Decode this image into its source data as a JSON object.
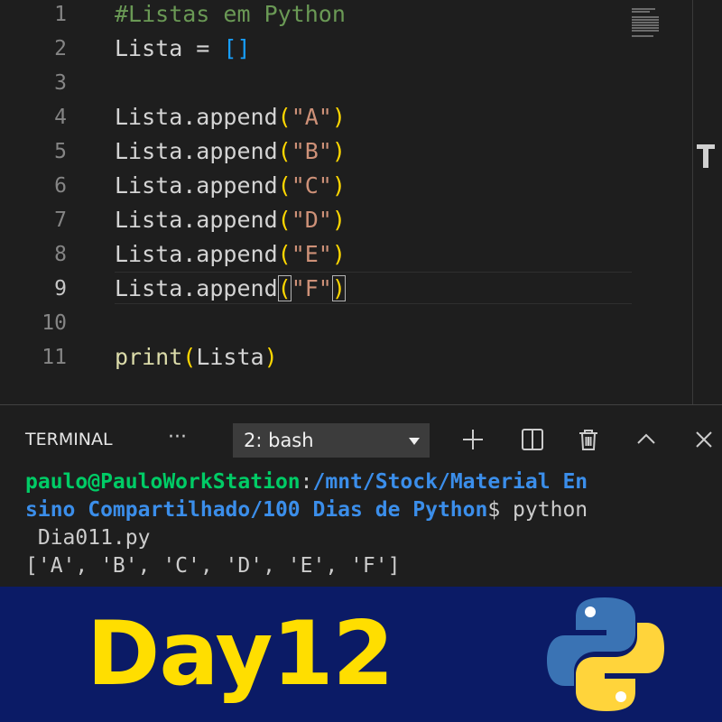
{
  "editor": {
    "lines": [
      {
        "number": "1",
        "tokens": [
          {
            "t": "#Listas em Python",
            "c": "comment"
          }
        ]
      },
      {
        "number": "2",
        "tokens": [
          {
            "t": "Lista = ",
            "c": "ident"
          },
          {
            "t": "[]",
            "c": "br1"
          }
        ]
      },
      {
        "number": "3",
        "tokens": []
      },
      {
        "number": "4",
        "tokens": [
          {
            "t": "Lista.append",
            "c": "ident"
          },
          {
            "t": "(",
            "c": "br2"
          },
          {
            "t": "\"A\"",
            "c": "string"
          },
          {
            "t": ")",
            "c": "br2"
          }
        ]
      },
      {
        "number": "5",
        "tokens": [
          {
            "t": "Lista.append",
            "c": "ident"
          },
          {
            "t": "(",
            "c": "br2"
          },
          {
            "t": "\"B\"",
            "c": "string"
          },
          {
            "t": ")",
            "c": "br2"
          }
        ]
      },
      {
        "number": "6",
        "tokens": [
          {
            "t": "Lista.append",
            "c": "ident"
          },
          {
            "t": "(",
            "c": "br2"
          },
          {
            "t": "\"C\"",
            "c": "string"
          },
          {
            "t": ")",
            "c": "br2"
          }
        ]
      },
      {
        "number": "7",
        "tokens": [
          {
            "t": "Lista.append",
            "c": "ident"
          },
          {
            "t": "(",
            "c": "br2"
          },
          {
            "t": "\"D\"",
            "c": "string"
          },
          {
            "t": ")",
            "c": "br2"
          }
        ]
      },
      {
        "number": "8",
        "tokens": [
          {
            "t": "Lista.append",
            "c": "ident"
          },
          {
            "t": "(",
            "c": "br2"
          },
          {
            "t": "\"E\"",
            "c": "string"
          },
          {
            "t": ")",
            "c": "br2"
          }
        ]
      },
      {
        "number": "9",
        "current": true,
        "tokens": [
          {
            "t": "Lista.append",
            "c": "ident"
          },
          {
            "t": "(",
            "c": "br2 match"
          },
          {
            "t": "\"F\"",
            "c": "string"
          },
          {
            "t": ")",
            "c": "br2 match"
          }
        ]
      },
      {
        "number": "10",
        "tokens": []
      },
      {
        "number": "11",
        "tokens": [
          {
            "t": "print",
            "c": "func"
          },
          {
            "t": "(",
            "c": "br2"
          },
          {
            "t": "Lista",
            "c": "ident"
          },
          {
            "t": ")",
            "c": "br2"
          }
        ]
      }
    ]
  },
  "terminal_panel": {
    "title": "TERMINAL",
    "more_label": "···",
    "selected_terminal": "2: bash",
    "tools": [
      "plus-icon",
      "split-icon",
      "trash-icon",
      "chevron-up-icon",
      "close-icon"
    ],
    "output_lines": [
      [
        {
          "t": "paulo@PauloWorkStation",
          "c": "user"
        },
        {
          "t": ":",
          "c": "plain"
        },
        {
          "t": "/mnt/Stock/Material En",
          "c": "path"
        }
      ],
      [
        {
          "t": "sino Compartilhado/100 Dias de Python",
          "c": "path"
        },
        {
          "t": "$ python",
          "c": "plain"
        }
      ],
      [
        {
          "t": " Dia011.py",
          "c": "plain"
        }
      ],
      [
        {
          "t": "['A', 'B', 'C', 'D', 'E', 'F']",
          "c": "plain"
        }
      ]
    ]
  },
  "banner": {
    "title": "Day12",
    "logo": "python-logo",
    "colors": {
      "background": "#0b1b66",
      "title": "#ffde00",
      "logo_blue": "#3a73b4",
      "logo_yellow": "#ffd43b"
    }
  },
  "theme": {
    "editor_background": "#1e1e1e",
    "comment": "#6a9955",
    "string": "#ce9178",
    "bracket_level1": "#179fff",
    "bracket_level2": "#ffd700",
    "function": "#dcdcaa",
    "terminal_user": "#00cc66",
    "terminal_path": "#3b8eea"
  }
}
